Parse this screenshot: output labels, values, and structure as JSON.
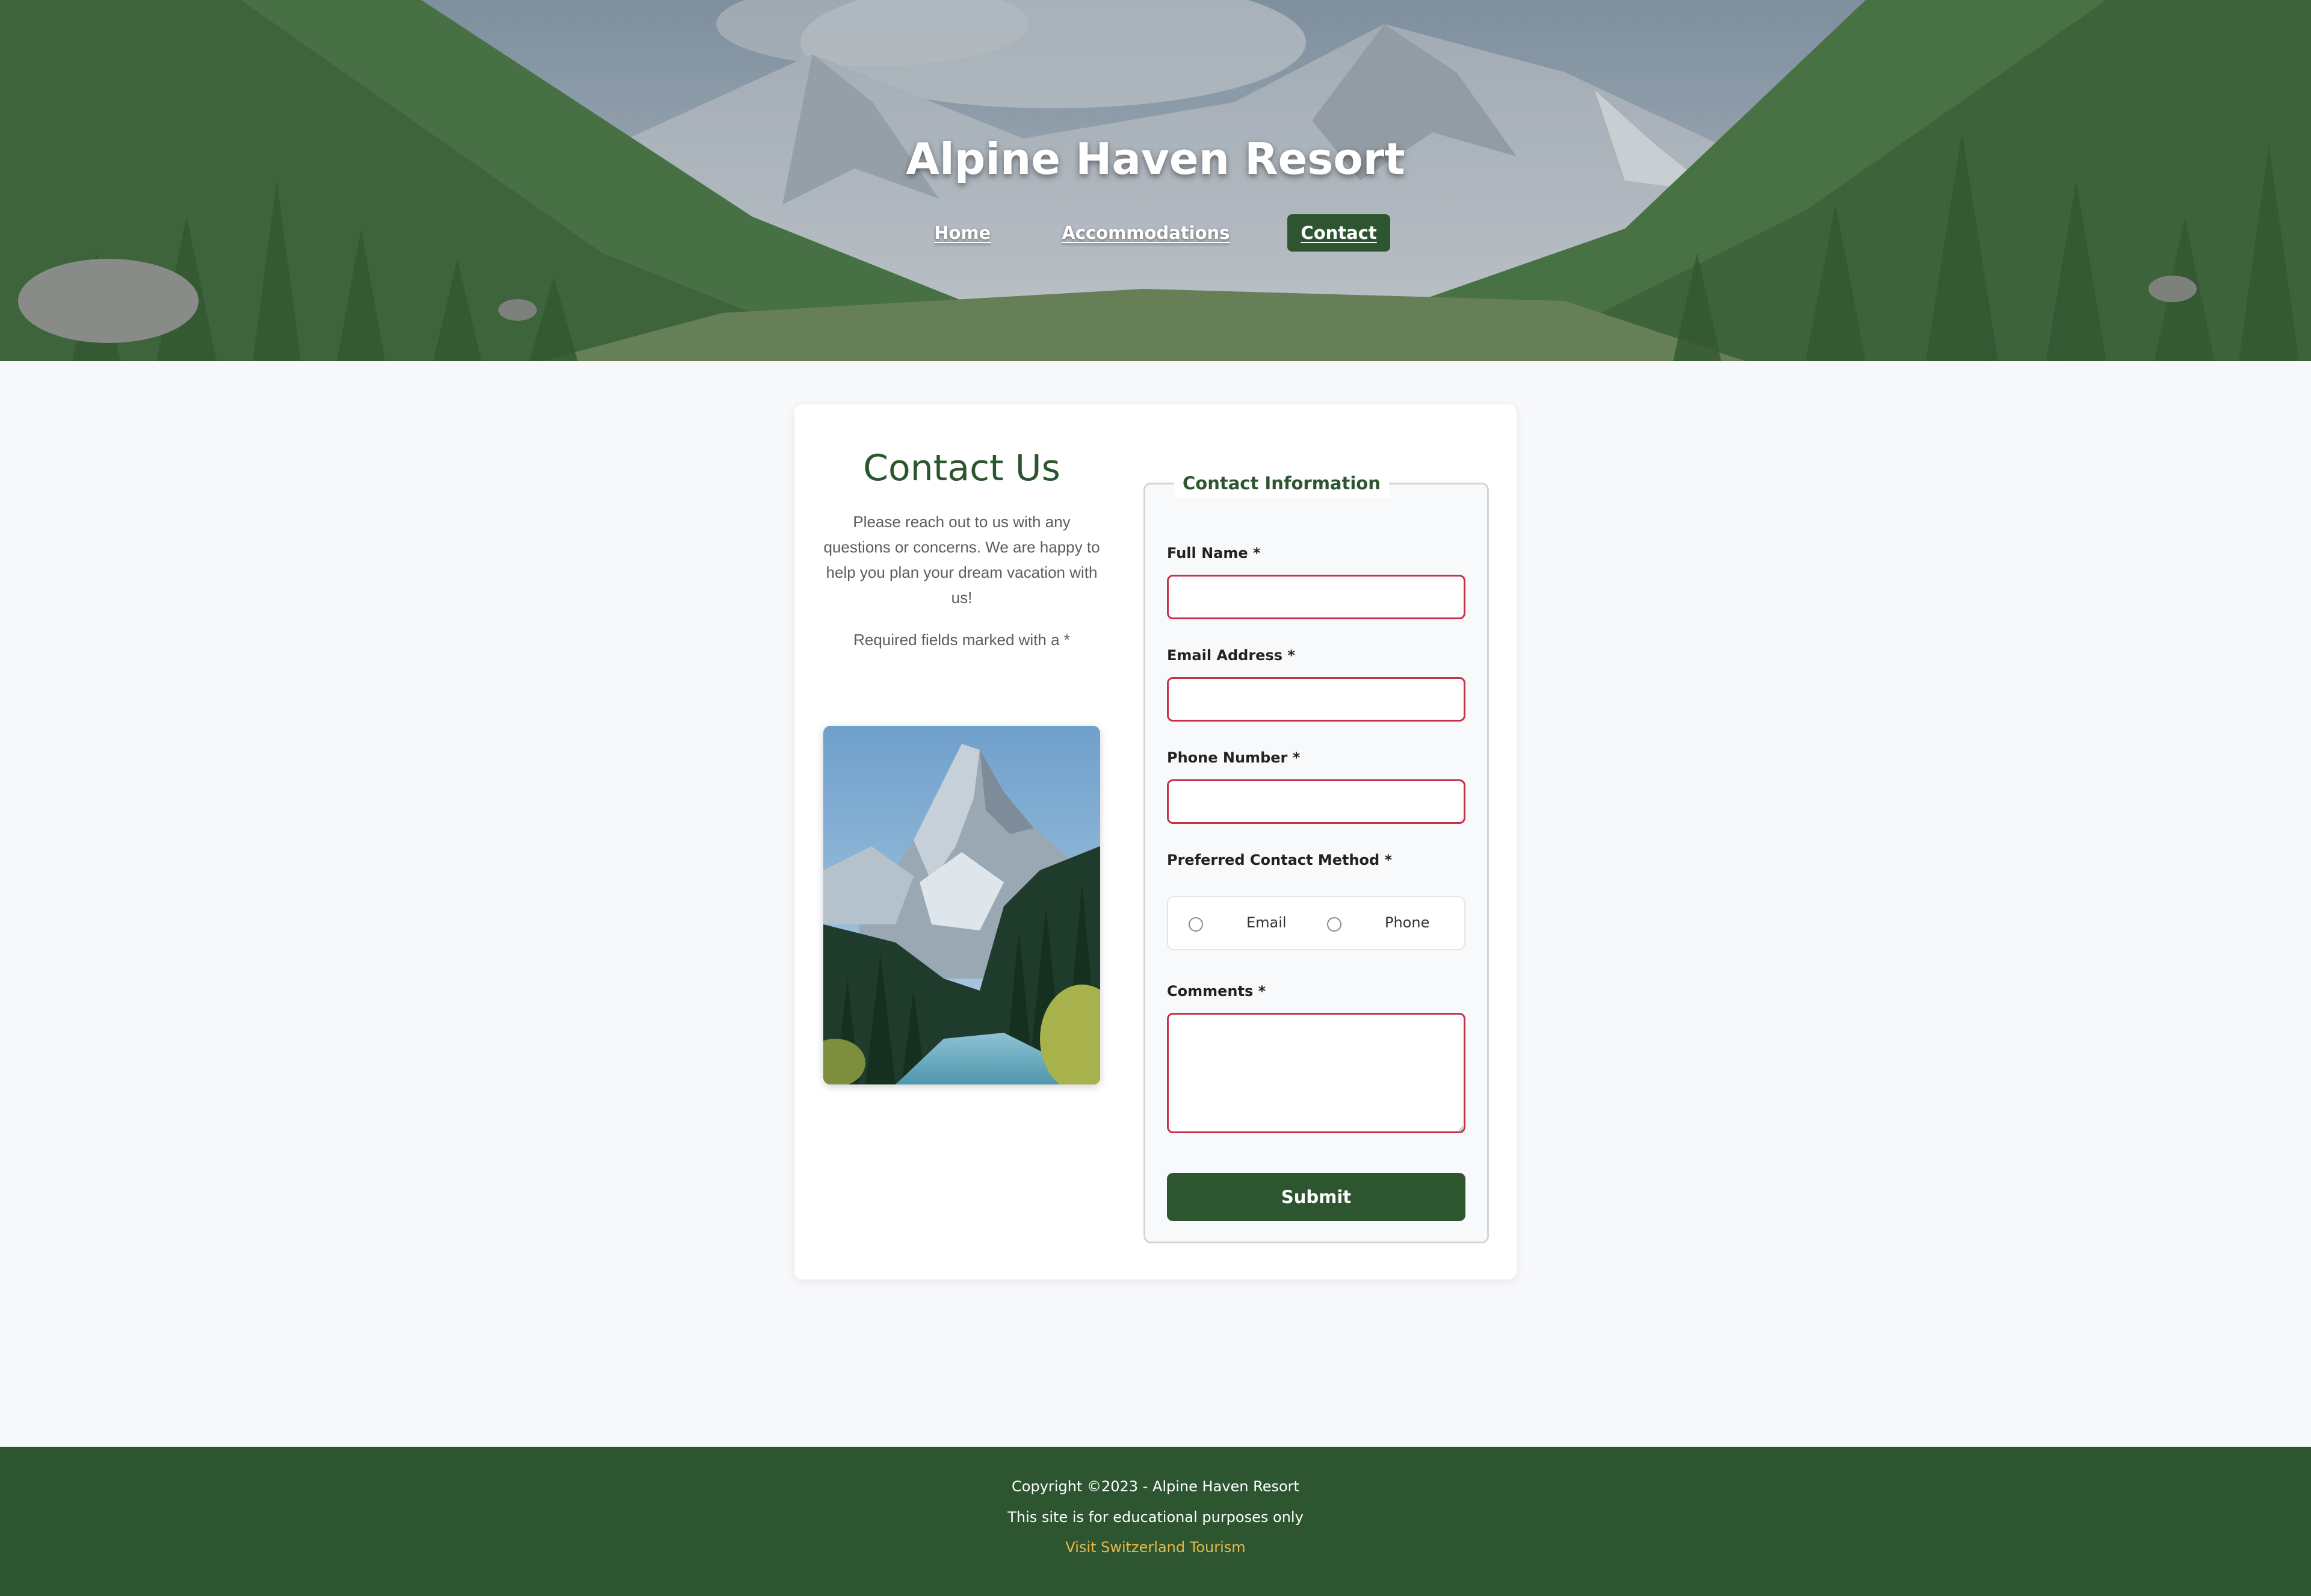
{
  "site": {
    "title": "Alpine Haven Resort"
  },
  "nav": {
    "items": [
      {
        "label": "Home"
      },
      {
        "label": "Accommodations"
      },
      {
        "label": "Contact"
      }
    ],
    "active": "Contact"
  },
  "contact": {
    "title": "Contact Us",
    "intro": "Please reach out to us with any questions or concerns. We are happy to help you plan your dream vacation with us!",
    "required_note": "Required fields marked with a *"
  },
  "form": {
    "legend": "Contact Information",
    "full_name_label": "Full Name *",
    "full_name_value": "",
    "email_label": "Email Address *",
    "email_value": "",
    "phone_label": "Phone Number *",
    "phone_value": "",
    "contact_method_label": "Preferred Contact Method *",
    "contact_method_options": [
      "Email",
      "Phone"
    ],
    "comments_label": "Comments *",
    "comments_value": "",
    "submit_label": "Submit"
  },
  "footer": {
    "copyright": "Copyright ©2023 - Alpine Haven Resort",
    "note": "This site is for educational purposes only",
    "link_text": "Visit Switzerland Tourism"
  },
  "colors": {
    "brand_green": "#2d5630",
    "invalid_border": "#c9304a",
    "link_gold": "#e8b94a",
    "page_bg": "#f7f8fa"
  },
  "icons": {
    "hero_image": "mountain-valley-image",
    "side_photo": "mountain-peak-image"
  }
}
